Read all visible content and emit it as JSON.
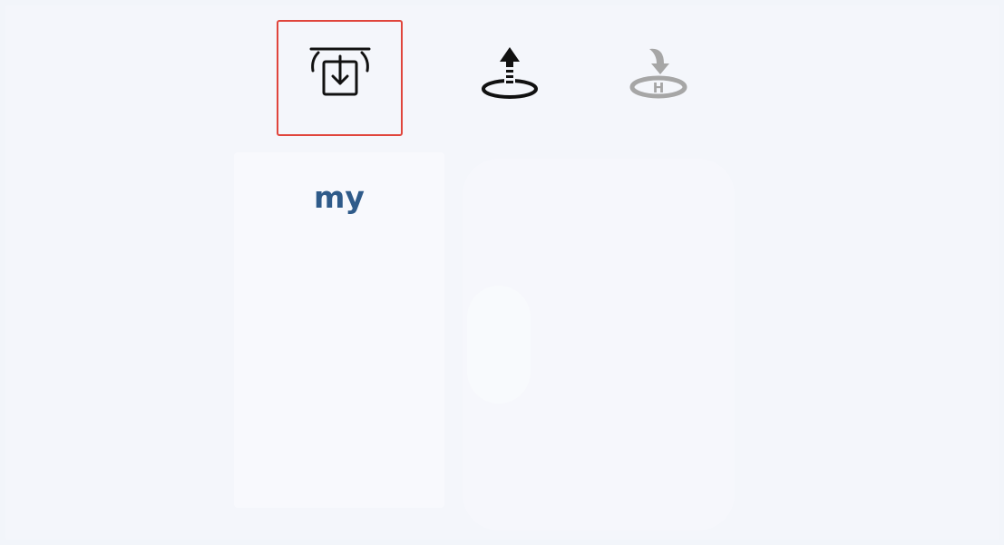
{
  "colors": {
    "selection_border": "#e0453c",
    "label": "#2f5b8a",
    "icon_dark": "#111111",
    "icon_muted": "#a6a6a6"
  },
  "toolbar": {
    "items": [
      {
        "icon": "download-to-device-icon",
        "selected": true
      },
      {
        "icon": "upload-takeoff-icon",
        "selected": false
      },
      {
        "icon": "return-home-landing-icon",
        "selected": false,
        "disabled": true
      }
    ]
  },
  "panel": {
    "label": "my"
  }
}
